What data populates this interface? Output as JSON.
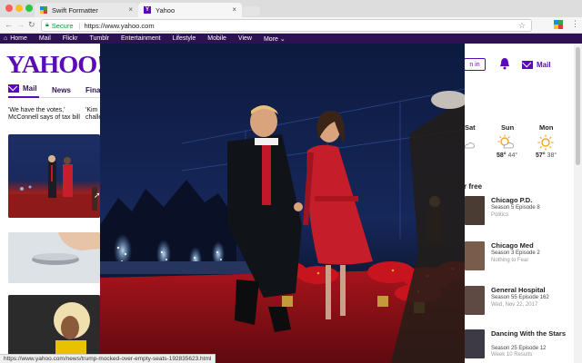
{
  "browser": {
    "tabs": [
      {
        "title": "Swift Formatter",
        "icon": "swift-formatter-favicon"
      },
      {
        "title": "Yahoo",
        "icon": "yahoo-favicon"
      }
    ],
    "secure_label": "Secure",
    "url": "https://www.yahoo.com"
  },
  "yahoo_nav": {
    "items": [
      "Home",
      "Mail",
      "Flickr",
      "Tumblr",
      "Entertainment",
      "Lifestyle",
      "Mobile",
      "View",
      "More"
    ]
  },
  "logo": "YAHOO!",
  "tabs_row": {
    "mail": "Mail",
    "news": "News",
    "finance": "Fina"
  },
  "headlines": {
    "one_line1": "'We have the votes,'",
    "one_line2": "McConnell says of tax bill",
    "two_line1": "'Kim",
    "two_line2": "challe"
  },
  "header_right": {
    "signin": "n in",
    "mail": "Mail"
  },
  "weather": [
    {
      "day": "Sat",
      "high": "",
      "low": ""
    },
    {
      "day": "Sun",
      "high": "58°",
      "low": "44°"
    },
    {
      "day": "Mon",
      "high": "57°",
      "low": "38°"
    }
  ],
  "free_heading": "r free",
  "shows": [
    {
      "title": "Chicago P.D.",
      "sub": "Season 5 Episode 8",
      "meta": "Politics"
    },
    {
      "title": "Chicago Med",
      "sub": "Season 3 Episode 2",
      "meta": "Nothing to Fear"
    },
    {
      "title": "General Hospital",
      "sub": "Season 55 Episode 162",
      "meta": "Wed, Nov 22, 2017"
    },
    {
      "title": "Dancing With the Stars",
      "sub": "Season 25 Episode 12",
      "meta": "Week 10 Results"
    }
  ],
  "status_url": "https://www.yahoo.com/news/trump-mocked-over-empty-seats-192835623.html",
  "colors": {
    "yahoo_purple": "#5a0bb7",
    "nav_purple": "#2d1152",
    "secure_green": "#1a8f3a"
  }
}
